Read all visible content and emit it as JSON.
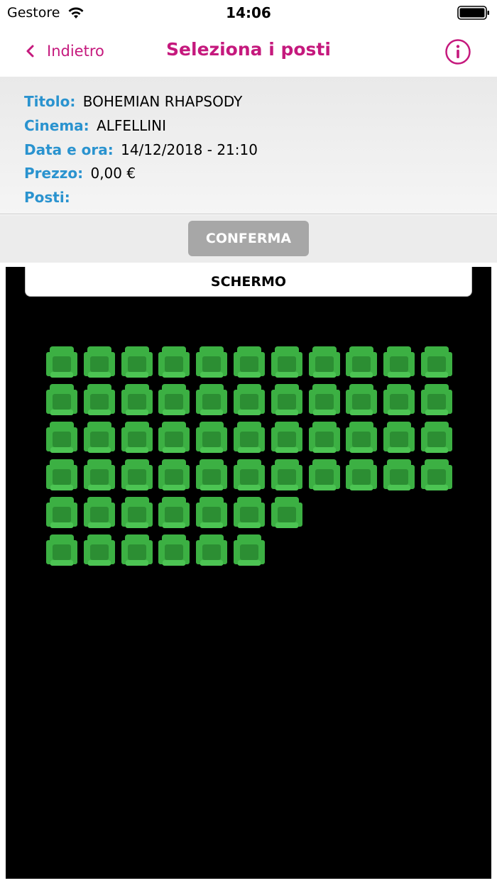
{
  "status_bar": {
    "carrier": "Gestore",
    "time": "14:06",
    "wifi_icon": "wifi-icon",
    "battery_icon": "battery-icon"
  },
  "nav": {
    "back_label": "Indietro",
    "title": "Seleziona i posti",
    "info_icon": "info-circle-icon",
    "accent_color": "#c5197d"
  },
  "details": {
    "title_label": "Titolo:",
    "title_value": "BOHEMIAN RHAPSODY",
    "cinema_label": "Cinema:",
    "cinema_value": "ALFELLINI",
    "datetime_label": "Data e ora:",
    "datetime_value": "14/12/2018 - 21:10",
    "price_label": "Prezzo:",
    "price_value": "0,00 €",
    "seats_label": "Posti:",
    "seats_value": "",
    "label_color": "#2a93cf"
  },
  "confirm_label": "CONFERMA",
  "screen_label": "SCHERMO",
  "seat_map": {
    "seat_color": "#3cb043",
    "seat_state": "available",
    "rows": [
      11,
      11,
      11,
      11,
      7,
      6
    ]
  }
}
